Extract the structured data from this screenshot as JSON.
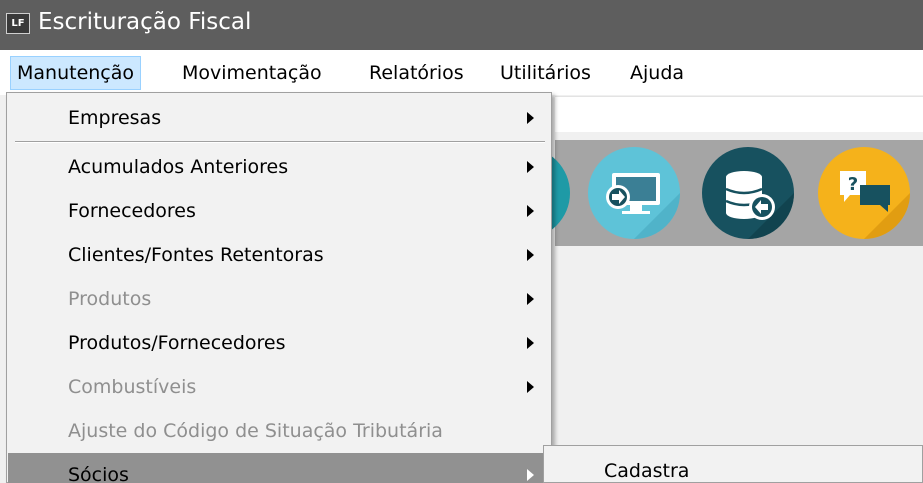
{
  "window": {
    "icon_text": "LF",
    "title": "Escrituração Fiscal"
  },
  "menubar": {
    "items": [
      {
        "label": "Manutenção"
      },
      {
        "label": "Movimentação"
      },
      {
        "label": "Relatórios"
      },
      {
        "label": "Utilitários"
      },
      {
        "label": "Ajuda"
      }
    ]
  },
  "toolbar": {
    "icons": [
      "partial-teal-icon",
      "monitor-arrow-icon",
      "database-back-icon",
      "help-chat-icon"
    ]
  },
  "dropdown": {
    "items": [
      {
        "label": "Empresas",
        "has_submenu": true,
        "enabled": true
      },
      {
        "label": "Acumulados Anteriores",
        "has_submenu": true,
        "enabled": true
      },
      {
        "label": "Fornecedores",
        "has_submenu": true,
        "enabled": true
      },
      {
        "label": "Clientes/Fontes Retentoras",
        "has_submenu": true,
        "enabled": true
      },
      {
        "label": "Produtos",
        "has_submenu": true,
        "enabled": false
      },
      {
        "label": "Produtos/Fornecedores",
        "has_submenu": true,
        "enabled": true
      },
      {
        "label": "Combustíveis",
        "has_submenu": true,
        "enabled": false
      },
      {
        "label": "Ajuste do Código de Situação Tributária",
        "has_submenu": false,
        "enabled": false
      },
      {
        "label": "Sócios",
        "has_submenu": true,
        "enabled": true,
        "highlighted": true
      }
    ]
  },
  "submenu": {
    "items": [
      {
        "label": "Cadastra"
      }
    ]
  },
  "colors": {
    "titlebar": "#5e5e5e",
    "menu_active": "#cce8ff",
    "highlight": "#919191",
    "disabled_text": "#8f8f8f"
  }
}
